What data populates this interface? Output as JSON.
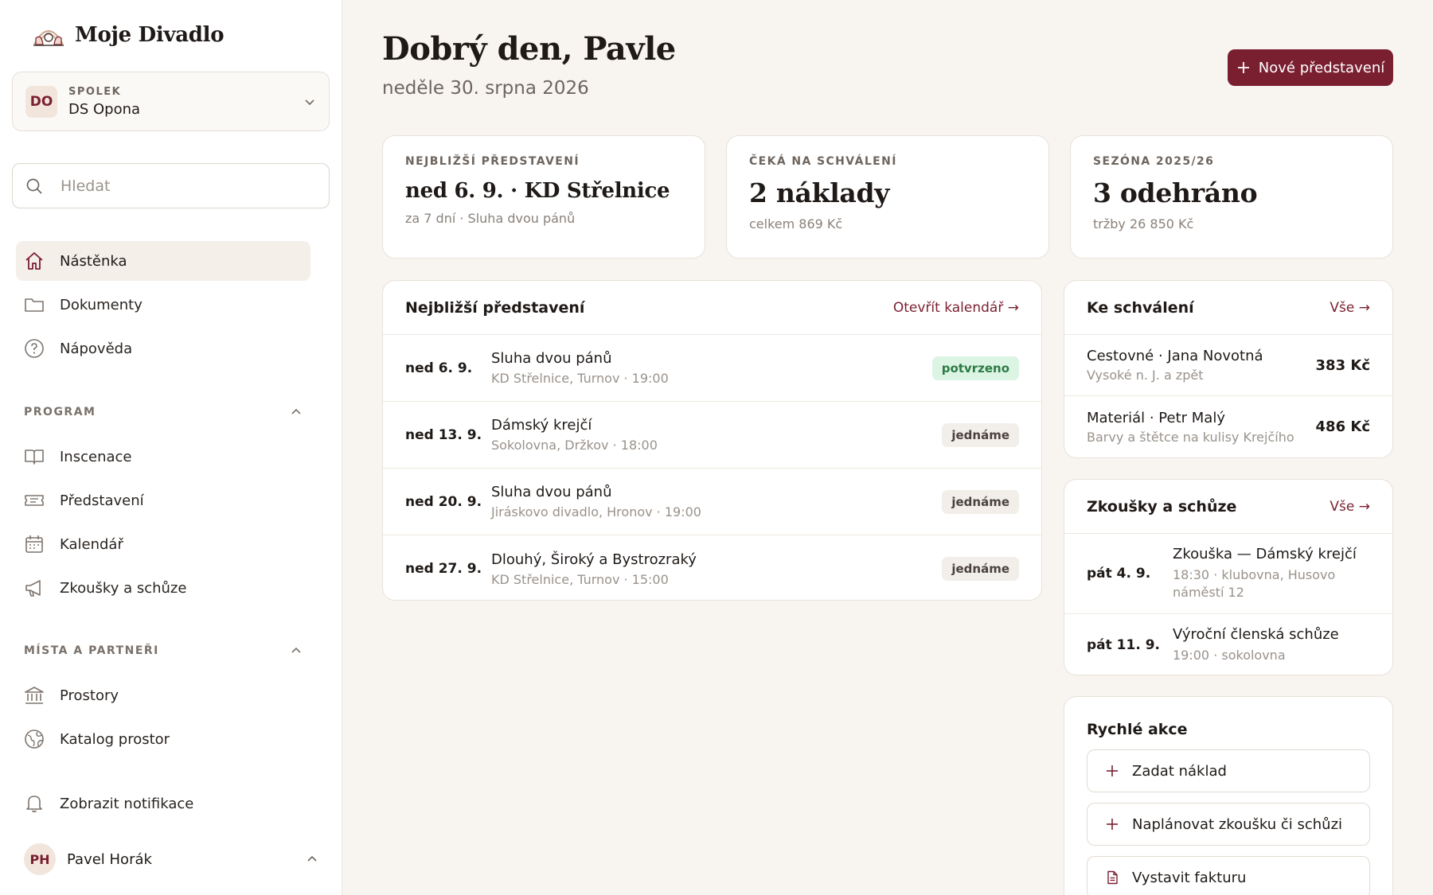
{
  "app": {
    "name": "Moje Divadlo"
  },
  "org": {
    "kicker": "SPOLEK",
    "badge": "DO",
    "name": "DS Opona"
  },
  "search": {
    "placeholder": "Hledat"
  },
  "nav": {
    "top": [
      {
        "label": "Nástěnka",
        "icon": "home-icon"
      },
      {
        "label": "Dokumenty",
        "icon": "folder-icon"
      },
      {
        "label": "Nápověda",
        "icon": "help-icon"
      }
    ],
    "program": {
      "title": "PROGRAM",
      "items": [
        {
          "label": "Inscenace",
          "icon": "book-icon"
        },
        {
          "label": "Představení",
          "icon": "ticket-icon"
        },
        {
          "label": "Kalendář",
          "icon": "calendar-icon"
        },
        {
          "label": "Zkoušky a schůze",
          "icon": "megaphone-icon"
        }
      ]
    },
    "places": {
      "title": "MÍSTA A PARTNEŘI",
      "items": [
        {
          "label": "Prostory",
          "icon": "building-icon"
        },
        {
          "label": "Katalog prostor",
          "icon": "globe-icon"
        }
      ]
    },
    "notifications": "Zobrazit notifikace"
  },
  "user": {
    "initials": "PH",
    "name": "Pavel Horák"
  },
  "header": {
    "greeting": "Dobrý den, Pavle",
    "date": "neděle 30. srpna 2026",
    "new_button": "Nové představení"
  },
  "stats": [
    {
      "kicker": "NEJBLIŽŠÍ PŘEDSTAVENÍ",
      "value": "ned 6. 9. · KD Střelnice",
      "sub": "za 7 dní · Sluha dvou pánů"
    },
    {
      "kicker": "ČEKÁ NA SCHVÁLENÍ",
      "value": "2 náklady",
      "sub": "celkem 869 Kč"
    },
    {
      "kicker": "SEZÓNA 2025/26",
      "value": "3 odehráno",
      "sub": "tržby 26 850 Kč"
    }
  ],
  "upcoming": {
    "title": "Nejbližší představení",
    "link": "Otevřít kalendář →",
    "rows": [
      {
        "date": "ned 6. 9.",
        "title": "Sluha dvou pánů",
        "meta": "KD Střelnice, Turnov · 19:00",
        "status": "potvrzeno"
      },
      {
        "date": "ned 13. 9.",
        "title": "Dámský krejčí",
        "meta": "Sokolovna, Držkov · 18:00",
        "status": "jednáme"
      },
      {
        "date": "ned 20. 9.",
        "title": "Sluha dvou pánů",
        "meta": "Jiráskovo divadlo, Hronov · 19:00",
        "status": "jednáme"
      },
      {
        "date": "ned 27. 9.",
        "title": "Dlouhý, Široký a Bystrozraký",
        "meta": "KD Střelnice, Turnov · 15:00",
        "status": "jednáme"
      }
    ]
  },
  "approvals": {
    "title": "Ke schválení",
    "link": "Vše →",
    "rows": [
      {
        "title": "Cestovné · Jana Novotná",
        "meta": "Vysoké n. J. a zpět",
        "amount": "383 Kč"
      },
      {
        "title": "Materiál · Petr Malý",
        "meta": "Barvy a štětce na kulisy Krejčího",
        "amount": "486 Kč"
      }
    ]
  },
  "meetings": {
    "title": "Zkoušky a schůze",
    "link": "Vše →",
    "rows": [
      {
        "date": "pát 4. 9.",
        "title": "Zkouška — Dámský krejčí",
        "meta": "18:30 · klubovna, Husovo náměstí 12"
      },
      {
        "date": "pát 11. 9.",
        "title": "Výroční členská schůze",
        "meta": "19:00 · sokolovna"
      }
    ]
  },
  "quick": {
    "title": "Rychlé akce",
    "actions": [
      {
        "label": "Zadat náklad",
        "icon": "plus-icon"
      },
      {
        "label": "Naplánovat zkoušku či schůzi",
        "icon": "plus-icon"
      },
      {
        "label": "Vystavit fakturu",
        "icon": "document-icon"
      }
    ]
  },
  "colors": {
    "accent": "#7a1f30",
    "background": "#f8f5f1",
    "success_bg": "#dcf4e4",
    "success_text": "#2d7a45"
  }
}
